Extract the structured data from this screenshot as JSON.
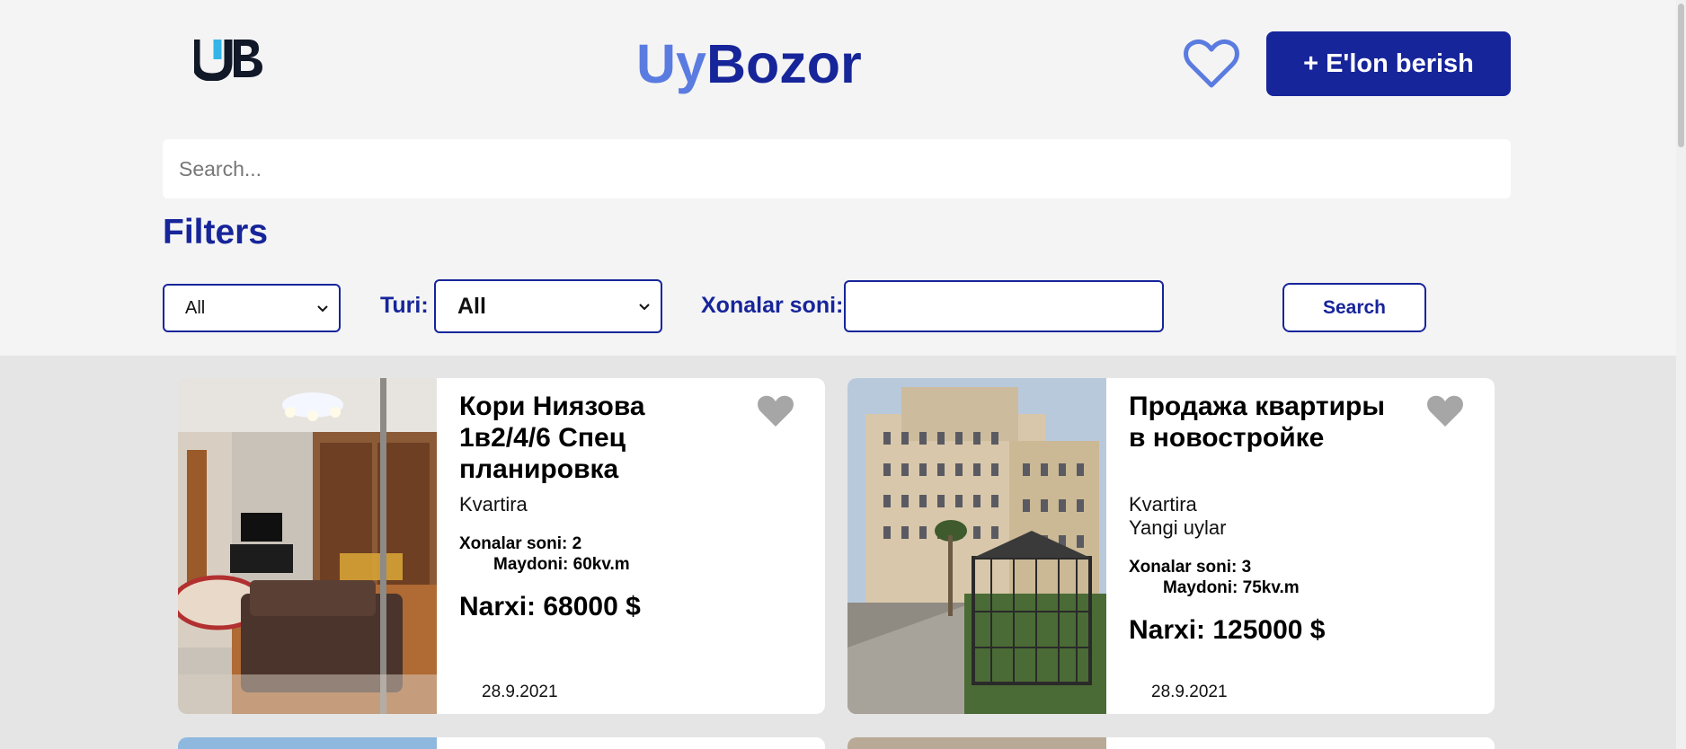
{
  "header": {
    "logo_text": "UB",
    "title_part1": "Uy",
    "title_part2": "Bozor",
    "post_button_label": "+ E'lon berish"
  },
  "search": {
    "placeholder": "Search...",
    "value": ""
  },
  "filters": {
    "title": "Filters",
    "first_select_value": "All",
    "type_label": "Turi:",
    "type_select_value": "All",
    "rooms_label": "Xonalar soni:",
    "rooms_value": "",
    "search_button_label": "Search"
  },
  "listings": [
    {
      "title": "Кори Ниязова 1в2/4/6 Спец планировка",
      "category": "Kvartira",
      "subcategory": "",
      "rooms": "Xonalar soni: 2",
      "area": "Maydoni: 60kv.m",
      "price": "Narxi: 68000 $",
      "date": "28.9.2021"
    },
    {
      "title": "Продажа квартиры в новостройке",
      "category": "Kvartira",
      "subcategory": "Yangi uylar",
      "rooms": "Xonalar soni: 3",
      "area": "Maydoni: 75kv.m",
      "price": "Narxi: 125000 $",
      "date": "28.9.2021"
    }
  ],
  "icons": {
    "header_favorite": "heart-outline-icon",
    "card_favorite": "heart-filled-icon",
    "select_arrow": "chevron-down-icon"
  },
  "colors": {
    "brand_dark": "#17259a",
    "brand_light": "#5a7be0",
    "heart_gray": "#a6a6a6"
  }
}
